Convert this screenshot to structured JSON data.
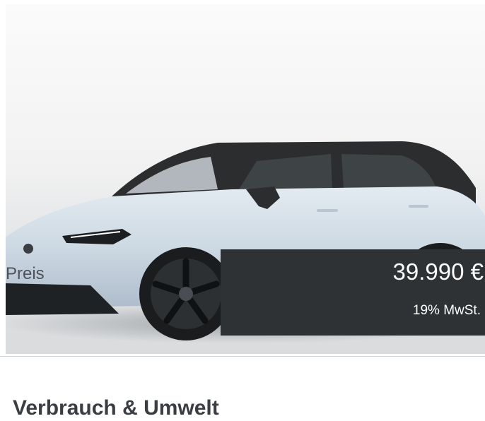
{
  "vehicle": {
    "image_alt": "Volvo EX30 vehicle image",
    "body_color": "#cdd9e3",
    "roof_color": "#2b2d2f"
  },
  "price": {
    "label": "Preis",
    "value": "39.990 €",
    "tax_note": "19% MwSt."
  },
  "sections": {
    "consumption_title": "Verbrauch & Umwelt"
  }
}
